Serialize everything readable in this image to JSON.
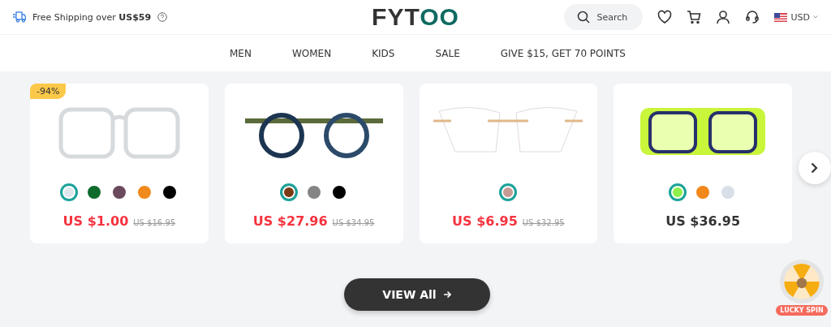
{
  "header": {
    "shipping_text": "Free Shipping over **US$59**",
    "logo": "FYTOO",
    "search": {
      "placeholder": "Search"
    },
    "currency": "USD"
  },
  "nav": {
    "items": [
      {
        "label": "MEN"
      },
      {
        "label": "WOMEN"
      },
      {
        "label": "KIDS"
      },
      {
        "label": "SALE"
      },
      {
        "label": "GIVE $15, GET 70 POINTS"
      }
    ]
  },
  "products": [
    {
      "badge": "-94%",
      "discounted": true,
      "price": "US $1.00",
      "old_price": "US $16.95",
      "swatches": [
        {
          "color": "#dfe6ec",
          "selected": true
        },
        {
          "color": "#0e6b2c",
          "selected": false
        },
        {
          "color": "#6b4a5e",
          "selected": false
        },
        {
          "color": "#f08a1c",
          "selected": false
        },
        {
          "color": "#000000",
          "selected": false
        }
      ]
    },
    {
      "discounted": true,
      "price": "US $27.96",
      "old_price": "US $34.95",
      "swatches": [
        {
          "color": "#7a3b14",
          "selected": true
        },
        {
          "color": "#858585",
          "selected": false
        },
        {
          "color": "#000000",
          "selected": false
        }
      ]
    },
    {
      "discounted": true,
      "price": "US $6.95",
      "old_price": "US $32.95",
      "swatches": [
        {
          "color": "#c79a94",
          "selected": true
        }
      ]
    },
    {
      "discounted": false,
      "price": "US $36.95",
      "swatches": [
        {
          "color": "#8ef04a",
          "selected": true
        },
        {
          "color": "#f2871c",
          "selected": false
        },
        {
          "color": "#d8dfe8",
          "selected": false
        }
      ]
    }
  ],
  "view_all": "VIEW All",
  "lucky_spin": "LUCKY SPIN"
}
